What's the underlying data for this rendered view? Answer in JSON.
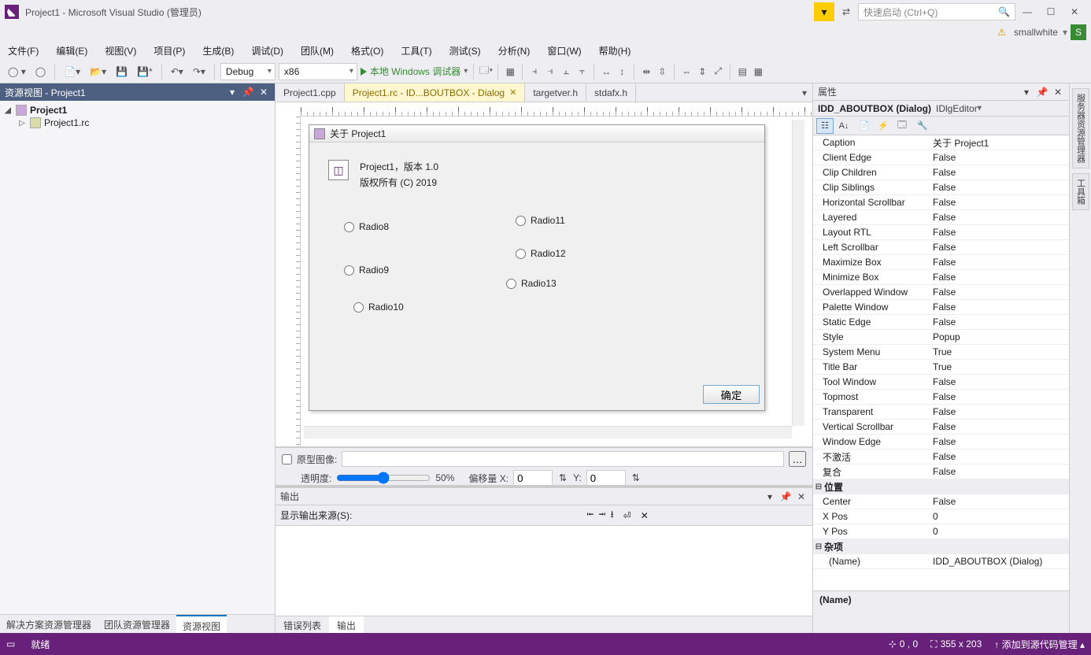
{
  "titlebar": {
    "title": "Project1 - Microsoft Visual Studio (管理员)",
    "search_placeholder": "快速启动 (Ctrl+Q)",
    "user": "smallwhite",
    "initial": "S"
  },
  "menu": [
    "文件(F)",
    "编辑(E)",
    "视图(V)",
    "项目(P)",
    "生成(B)",
    "调试(D)",
    "团队(M)",
    "格式(O)",
    "工具(T)",
    "测试(S)",
    "分析(N)",
    "窗口(W)",
    "帮助(H)"
  ],
  "toolbar": {
    "config": "Debug",
    "platform": "x86",
    "run_label": "本地 Windows 调试器"
  },
  "left_panel": {
    "title": "资源视图 - Project1",
    "tree": {
      "root": "Project1",
      "child": "Project1.rc"
    },
    "bottom_tabs": [
      "解决方案资源管理器",
      "团队资源管理器",
      "资源视图"
    ],
    "active_bottom_tab": 2
  },
  "editor_tabs": [
    {
      "label": "Project1.cpp",
      "active": false
    },
    {
      "label": "Project1.rc - ID...BOUTBOX - Dialog",
      "active": true,
      "closable": true
    },
    {
      "label": "targetver.h",
      "active": false
    },
    {
      "label": "stdafx.h",
      "active": false
    }
  ],
  "dialog": {
    "title": "关于 Project1",
    "line1": "Project1，版本 1.0",
    "line2": "版权所有 (C) 2019",
    "radios_left": [
      "Radio8",
      "Radio9",
      "Radio10"
    ],
    "radios_right": [
      "Radio11",
      "Radio12",
      "Radio13"
    ],
    "ok": "确定"
  },
  "design_footer": {
    "proto_label": "原型图像:",
    "opacity_label": "透明度:",
    "opacity_value": "50%",
    "offset_label": "偏移量 X:",
    "offset_x": "0",
    "offset_y_label": "Y:",
    "offset_y": "0"
  },
  "output": {
    "title": "输出",
    "source_label": "显示输出来源(S):",
    "bottom_tabs": [
      "错误列表",
      "输出"
    ],
    "active": 1
  },
  "properties": {
    "title": "属性",
    "object": "IDD_ABOUTBOX (Dialog)",
    "editor": "IDlgEditor",
    "rows": [
      {
        "name": "Caption",
        "value": "关于 Project1"
      },
      {
        "name": "Client Edge",
        "value": "False"
      },
      {
        "name": "Clip Children",
        "value": "False"
      },
      {
        "name": "Clip Siblings",
        "value": "False"
      },
      {
        "name": "Horizontal Scrollbar",
        "value": "False"
      },
      {
        "name": "Layered",
        "value": "False"
      },
      {
        "name": "Layout RTL",
        "value": "False"
      },
      {
        "name": "Left Scrollbar",
        "value": "False"
      },
      {
        "name": "Maximize Box",
        "value": "False"
      },
      {
        "name": "Minimize Box",
        "value": "False"
      },
      {
        "name": "Overlapped Window",
        "value": "False"
      },
      {
        "name": "Palette Window",
        "value": "False"
      },
      {
        "name": "Static Edge",
        "value": "False"
      },
      {
        "name": "Style",
        "value": "Popup"
      },
      {
        "name": "System Menu",
        "value": "True"
      },
      {
        "name": "Title Bar",
        "value": "True"
      },
      {
        "name": "Tool Window",
        "value": "False"
      },
      {
        "name": "Topmost",
        "value": "False"
      },
      {
        "name": "Transparent",
        "value": "False"
      },
      {
        "name": "Vertical Scrollbar",
        "value": "False"
      },
      {
        "name": "Window Edge",
        "value": "False"
      },
      {
        "name": "不激活",
        "value": "False"
      },
      {
        "name": "复合",
        "value": "False"
      }
    ],
    "cat_pos": "位置",
    "rows_pos": [
      {
        "name": "Center",
        "value": "False"
      },
      {
        "name": "X Pos",
        "value": "0"
      },
      {
        "name": "Y Pos",
        "value": "0"
      }
    ],
    "cat_misc": "杂项",
    "rows_misc": [
      {
        "name": "(Name)",
        "value": "IDD_ABOUTBOX (Dialog)"
      }
    ],
    "desc_name": "(Name)"
  },
  "rightside_tabs": [
    "服务器资源管理器",
    "工具箱"
  ],
  "statusbar": {
    "ready": "就绪",
    "pos": "0 , 0",
    "size": "355 x 203",
    "scm": "添加到源代码管理"
  }
}
